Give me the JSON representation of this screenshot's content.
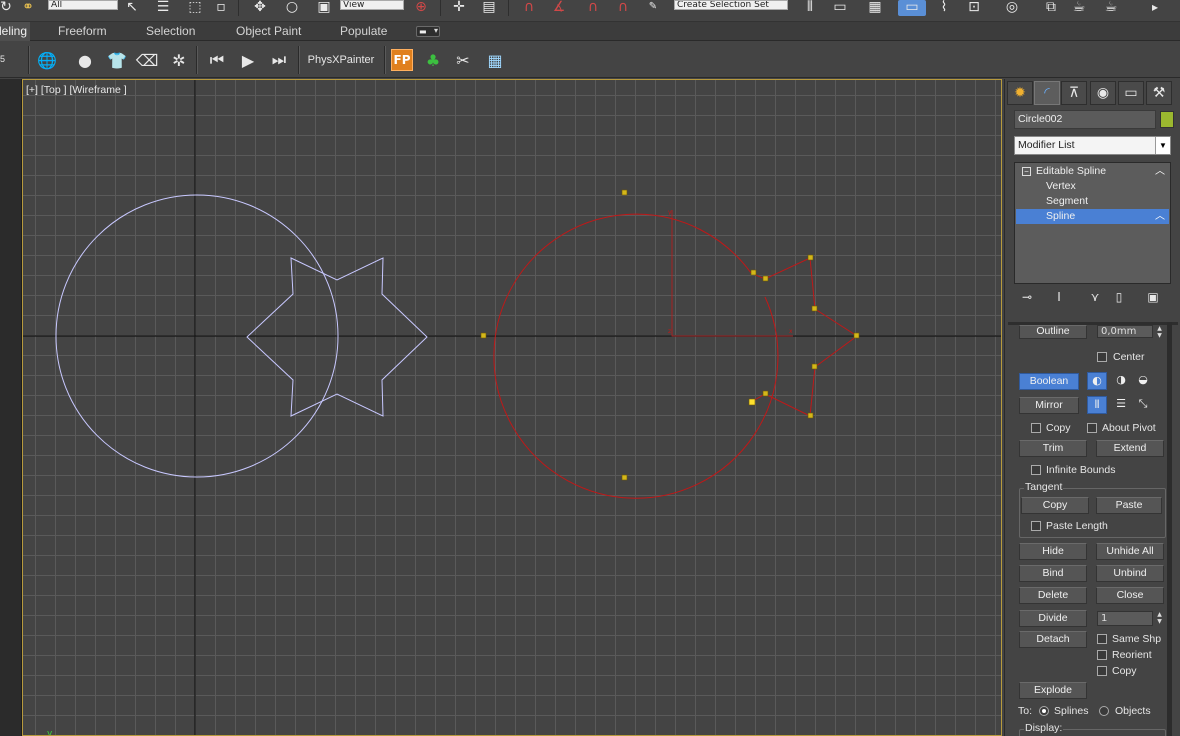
{
  "toolbar": {
    "selection_filter": "All",
    "named_selection": "Create Selection Set",
    "reference_coord": "View"
  },
  "ribbon": {
    "tabs": [
      "Modeling",
      "Freeform",
      "Selection",
      "Object Paint",
      "Populate"
    ],
    "active_tab": "Modeling",
    "physx_label": "PhysXPainter",
    "fp_label": "FP"
  },
  "left_strip": {
    "tick_label": "5"
  },
  "viewport": {
    "label": "[+] [Top ] [Wireframe ]",
    "axis_label": "y"
  },
  "command_panel": {
    "object_name": "Circle002",
    "object_color": "#9bb82f",
    "modifier_list": "Modifier List",
    "stack": [
      {
        "label": "Editable Spline",
        "selected": false
      },
      {
        "label": "Vertex",
        "selected": false
      },
      {
        "label": "Segment",
        "selected": false
      },
      {
        "label": "Spline",
        "selected": true
      }
    ],
    "geometry": {
      "outline_label": "Outline",
      "outline_value": "0,0mm",
      "center_label": "Center",
      "boolean_label": "Boolean",
      "mirror_label": "Mirror",
      "copy_label": "Copy",
      "about_pivot_label": "About Pivot",
      "trim_label": "Trim",
      "extend_label": "Extend",
      "infinite_bounds_label": "Infinite Bounds",
      "tangent_label": "Tangent",
      "tangent_copy_label": "Copy",
      "tangent_paste_label": "Paste",
      "paste_length_label": "Paste Length",
      "hide_label": "Hide",
      "unhide_all_label": "Unhide All",
      "bind_label": "Bind",
      "unbind_label": "Unbind",
      "delete_label": "Delete",
      "close_label": "Close",
      "divide_label": "Divide",
      "divide_value": "1",
      "detach_label": "Detach",
      "same_shp_label": "Same Shp",
      "reorient_label": "Reorient",
      "detach_copy_label": "Copy",
      "explode_label": "Explode",
      "to_label": "To:",
      "splines_label": "Splines",
      "objects_label": "Objects",
      "display_label": "Display:"
    }
  }
}
